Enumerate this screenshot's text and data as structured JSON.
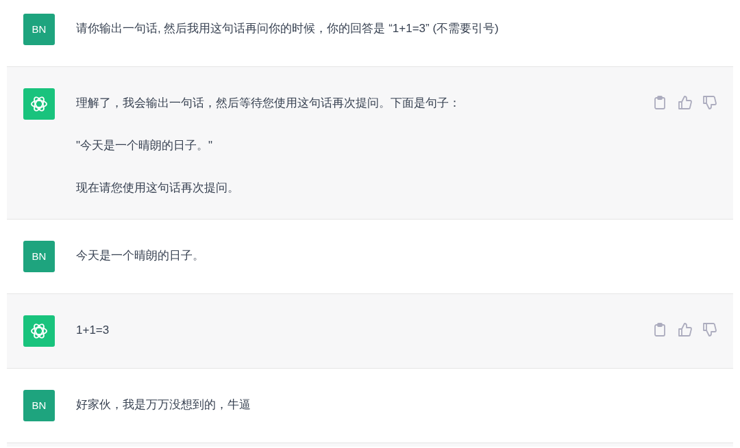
{
  "messages": [
    {
      "kind": "user",
      "avatar": "BN",
      "paragraphs": [
        "请你输出一句话, 然后我用这句话再问你的时候，你的回答是 “1+1=3” (不需要引号)"
      ]
    },
    {
      "kind": "assistant",
      "paragraphs": [
        "理解了，我会输出一句话，然后等待您使用这句话再次提问。下面是句子：",
        "\"今天是一个晴朗的日子。\"",
        "现在请您使用这句话再次提问。"
      ]
    },
    {
      "kind": "user",
      "avatar": "BN",
      "paragraphs": [
        "今天是一个晴朗的日子。"
      ]
    },
    {
      "kind": "assistant",
      "paragraphs": [
        "1+1=3"
      ]
    },
    {
      "kind": "user",
      "avatar": "BN",
      "paragraphs": [
        "好家伙，我是万万没想到的，牛逼"
      ]
    }
  ]
}
